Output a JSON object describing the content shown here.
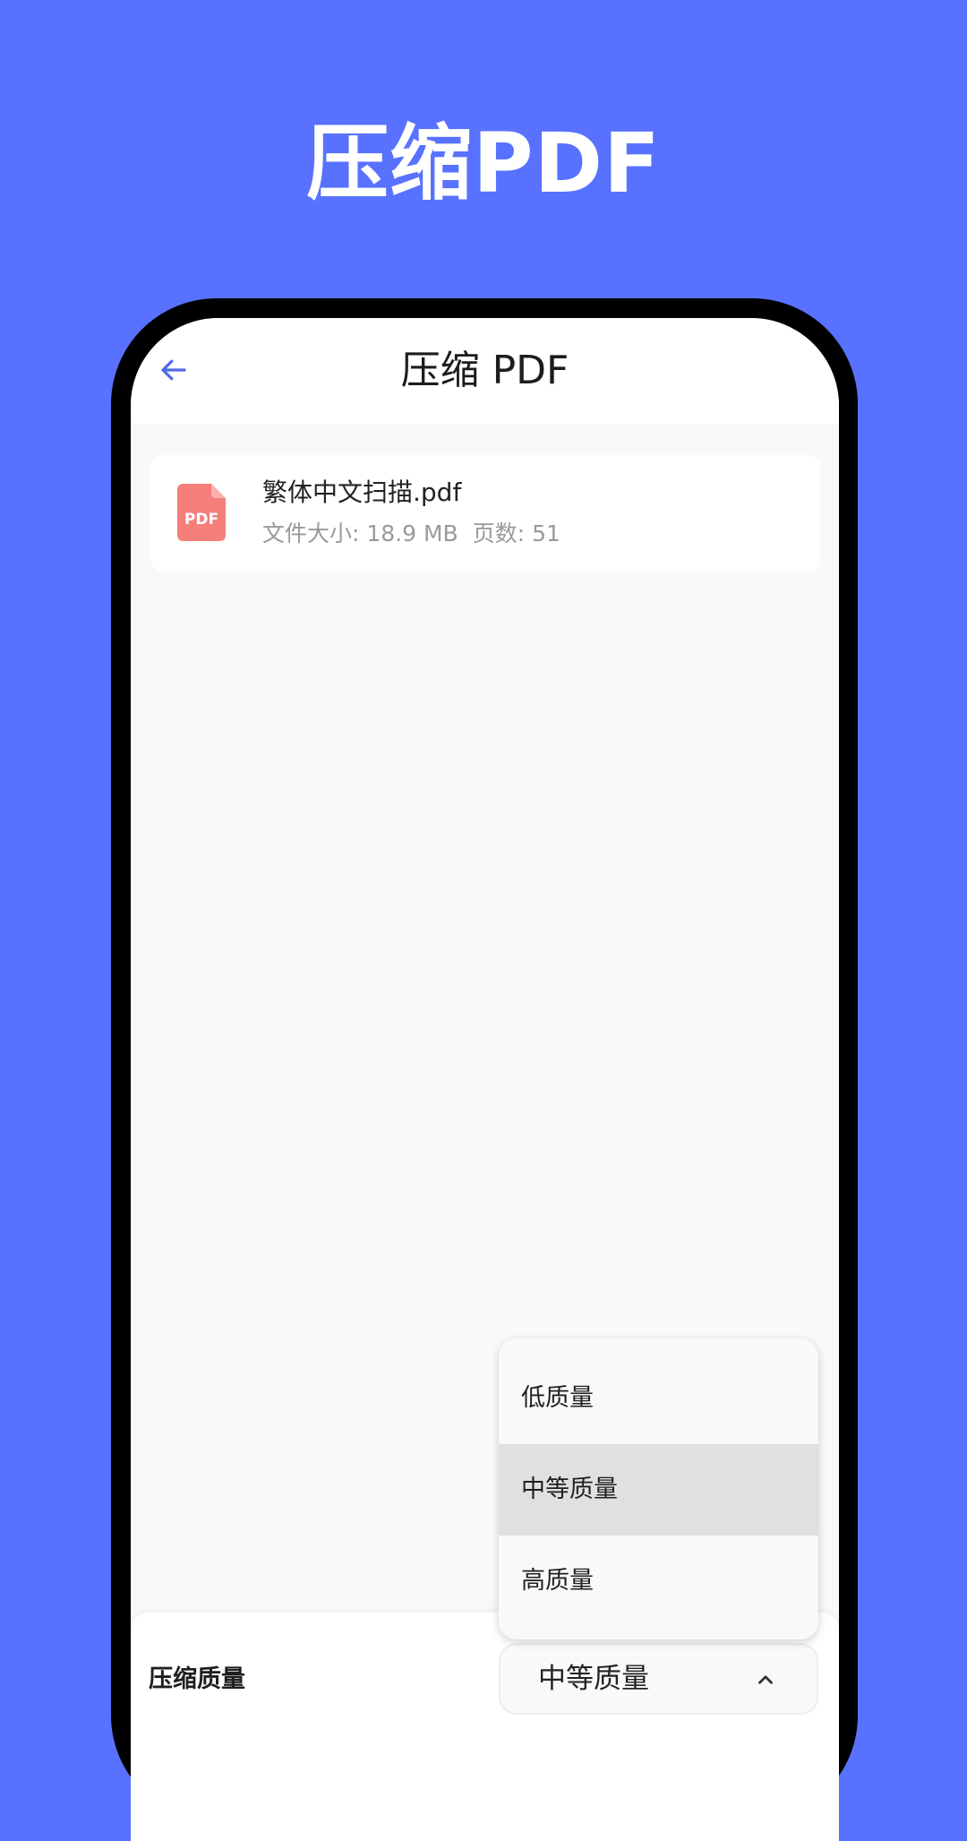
{
  "promo": {
    "title": "压缩PDF"
  },
  "app_bar": {
    "title": "压缩 PDF",
    "back_icon": "arrow-left-icon"
  },
  "file": {
    "icon": "pdf-file-icon",
    "icon_text": "PDF",
    "name": "繁体中文扫描.pdf",
    "size_text": "文件大小: 18.9 MB",
    "pages_text": "页数: 51"
  },
  "compression": {
    "label": "压缩质量",
    "selected": "中等质量",
    "options": [
      {
        "label": "低质量",
        "selected": false
      },
      {
        "label": "中等质量",
        "selected": true
      },
      {
        "label": "高质量",
        "selected": false
      }
    ]
  },
  "colors": {
    "background": "#5872FF",
    "accent": "#4F6BE8",
    "pdf_icon": "#F67E7B",
    "selected_option": "#E0E0E0"
  }
}
